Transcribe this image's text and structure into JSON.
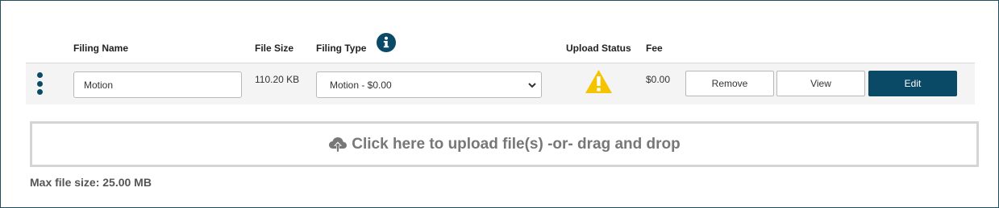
{
  "headers": {
    "filing_name": "Filing Name",
    "file_size": "File Size",
    "filing_type": "Filing Type",
    "upload_status": "Upload Status",
    "fee": "Fee"
  },
  "row": {
    "filing_name_value": "Motion",
    "file_size": "110.20 KB",
    "filing_type_selected": "Motion - $0.00",
    "upload_status_icon": "warning-triangle-icon",
    "fee": "$0.00",
    "buttons": {
      "remove": "Remove",
      "view": "View",
      "edit": "Edit"
    }
  },
  "dropzone": {
    "icon": "cloud-upload-icon",
    "label": "Click here to upload file(s) -or- drag and drop"
  },
  "max_file_size": "Max file size: 25.00 MB",
  "colors": {
    "brand": "#0b4a67",
    "warning": "#f5c400",
    "row_background": "#f4f4f4",
    "dropzone_border": "#d5d5d5"
  }
}
